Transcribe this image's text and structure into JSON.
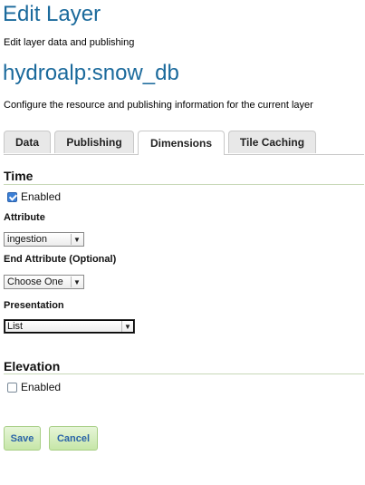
{
  "header": {
    "title": "Edit Layer",
    "subtitle": "Edit layer data and publishing"
  },
  "layer": {
    "name": "hydroalp:snow_db",
    "description": "Configure the resource and publishing information for the current layer"
  },
  "tabs": [
    {
      "label": "Data",
      "active": false
    },
    {
      "label": "Publishing",
      "active": false
    },
    {
      "label": "Dimensions",
      "active": true
    },
    {
      "label": "Tile Caching",
      "active": false
    }
  ],
  "time": {
    "title": "Time",
    "enabled_label": "Enabled",
    "enabled": true,
    "attribute_label": "Attribute",
    "attribute_value": "ingestion",
    "end_attribute_label": "End Attribute (Optional)",
    "end_attribute_value": "Choose One",
    "presentation_label": "Presentation",
    "presentation_value": "List"
  },
  "elevation": {
    "title": "Elevation",
    "enabled_label": "Enabled",
    "enabled": false
  },
  "actions": {
    "save_label": "Save",
    "cancel_label": "Cancel"
  },
  "colors": {
    "title_blue": "#1b6a9c",
    "button_green": "#c6e6a7",
    "button_text": "#2a63a8"
  }
}
